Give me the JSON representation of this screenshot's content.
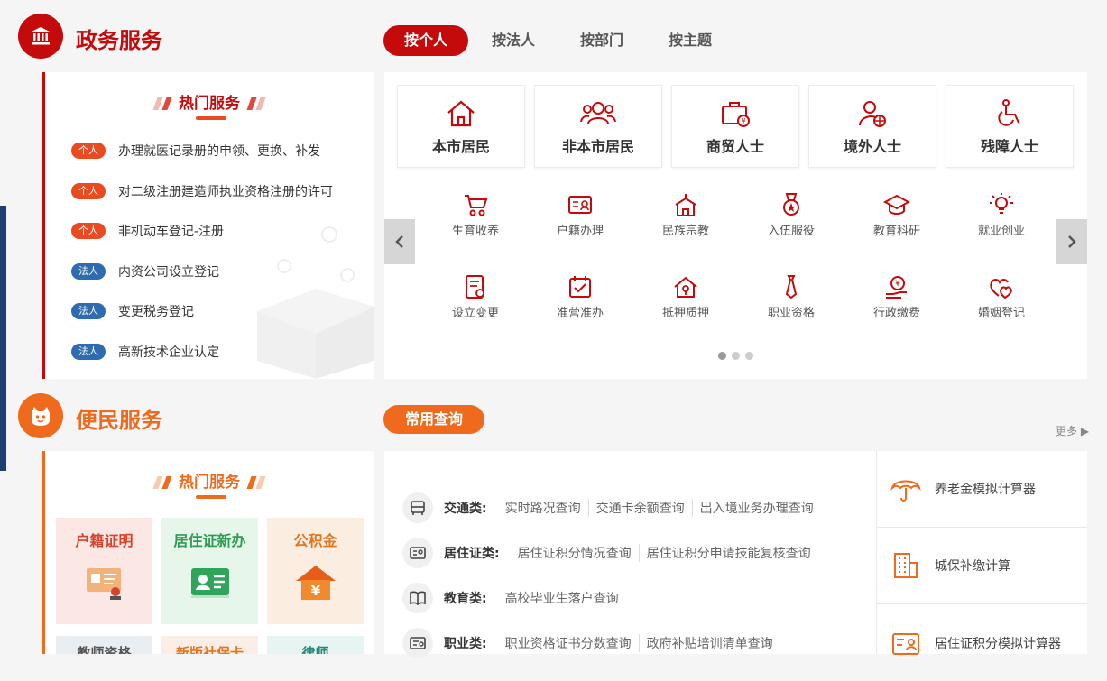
{
  "gov": {
    "title": "政务服务",
    "tabs": [
      "按个人",
      "按法人",
      "按部门",
      "按主题"
    ],
    "hot_title": "热门服务",
    "hot_services": [
      {
        "badge": "个人",
        "label": "办理就医记录册的申领、更换、补发"
      },
      {
        "badge": "个人",
        "label": "对二级注册建造师执业资格注册的许可"
      },
      {
        "badge": "个人",
        "label": "非机动车登记-注册"
      },
      {
        "badge": "法人",
        "label": "内资公司设立登记"
      },
      {
        "badge": "法人",
        "label": "变更税务登记"
      },
      {
        "badge": "法人",
        "label": "高新技术企业认定"
      }
    ],
    "categories": [
      "本市居民",
      "非本市居民",
      "商贸人士",
      "境外人士",
      "残障人士"
    ],
    "services_row1": [
      "生育收养",
      "户籍办理",
      "民族宗教",
      "入伍服役",
      "教育科研",
      "就业创业"
    ],
    "services_row2": [
      "设立变更",
      "准营准办",
      "抵押质押",
      "职业资格",
      "行政缴费",
      "婚姻登记"
    ],
    "carousel_page": 1,
    "carousel_total": 3
  },
  "life": {
    "title": "便民服务",
    "hot_title": "热门服务",
    "tiles": [
      {
        "label": "户籍证明",
        "icon": "id-card-stamp-icon"
      },
      {
        "label": "居住证新办",
        "icon": "contact-card-icon"
      },
      {
        "label": "公积金",
        "icon": "house-yuan-icon"
      }
    ],
    "tiles_row2": [
      "教师资格",
      "新版社保卡",
      "律师"
    ],
    "query_label": "常用查询",
    "more": "更多",
    "queries": [
      {
        "cat": "交通类:",
        "icon": "bus-icon",
        "links": [
          "实时路况查询",
          "交通卡余额查询",
          "出入境业务办理查询"
        ]
      },
      {
        "cat": "居住证类:",
        "icon": "id-card-icon",
        "links": [
          "居住证积分情况查询",
          "居住证积分申请技能复核查询"
        ]
      },
      {
        "cat": "教育类:",
        "icon": "book-icon",
        "links": [
          "高校毕业生落户查询"
        ]
      },
      {
        "cat": "职业类:",
        "icon": "certificate-icon",
        "links": [
          "职业资格证书分数查询",
          "政府补贴培训清单查询"
        ]
      }
    ],
    "calculators": [
      {
        "label": "养老金模拟计算器",
        "icon": "umbrella-icon"
      },
      {
        "label": "城保补缴计算",
        "icon": "building-icon"
      },
      {
        "label": "居住证积分模拟计算器",
        "icon": "id-card-icon"
      }
    ]
  },
  "colors": {
    "gov_red": "#c40a0a",
    "life_orange": "#ef6a1c",
    "badge_person": "#e94a1f",
    "badge_corp": "#2f6bb0"
  }
}
